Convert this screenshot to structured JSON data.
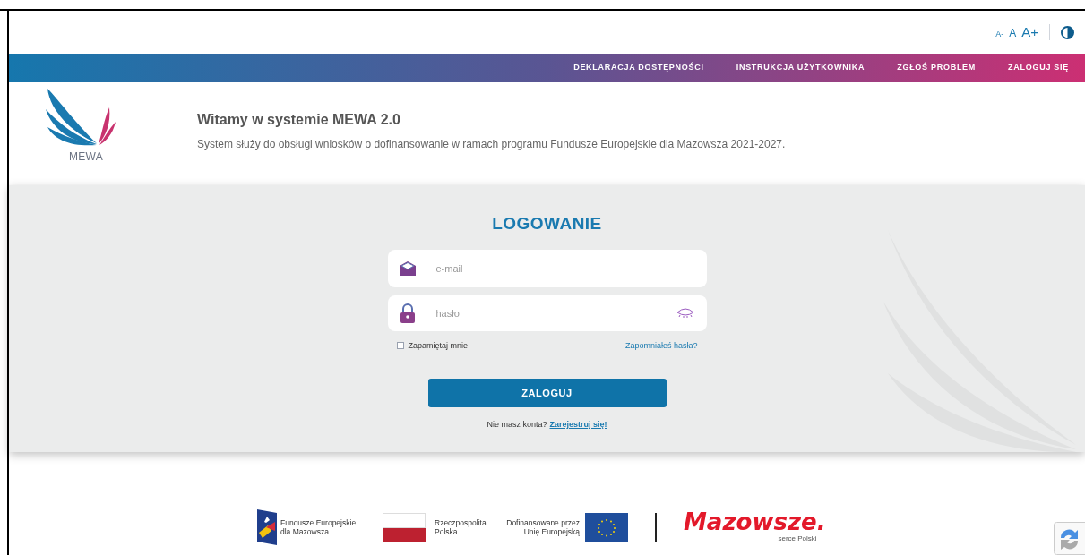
{
  "font_controls": [
    "A-",
    "A",
    "A+"
  ],
  "nav": [
    "DEKLARACJA DOSTĘPNOŚCI",
    "INSTRUKCJA UŻYTKOWNIKA",
    "ZGŁOŚ PROBLEM",
    "ZALOGUJ SIĘ"
  ],
  "logo": {
    "text": "MEWA"
  },
  "welcome": {
    "title": "Witamy w systemie MEWA 2.0",
    "description": "System służy do obsługi wniosków o dofinansowanie w ramach programu Fundusze Europejskie dla Mazowsza 2021-2027."
  },
  "login": {
    "title": "LOGOWANIE",
    "email_placeholder": "e-mail",
    "password_placeholder": "hasło",
    "remember": {
      "label": "Zapamiętaj mnie",
      "checked": false
    },
    "forgot": "Zapomniałeś hasła?",
    "button": "ZALOGUJ",
    "register_prompt": "Nie masz konta?",
    "register_link": "Zarejestruj się!"
  },
  "footer": {
    "fe": "Fundusze Europejskie dla Mazowsza",
    "rp": "Rzeczpospolita Polska",
    "eu": "Dofinansowane przez Unię Europejską",
    "mazowsze": "Mazowsze.",
    "mazowsze_sub": "serce Polski"
  }
}
